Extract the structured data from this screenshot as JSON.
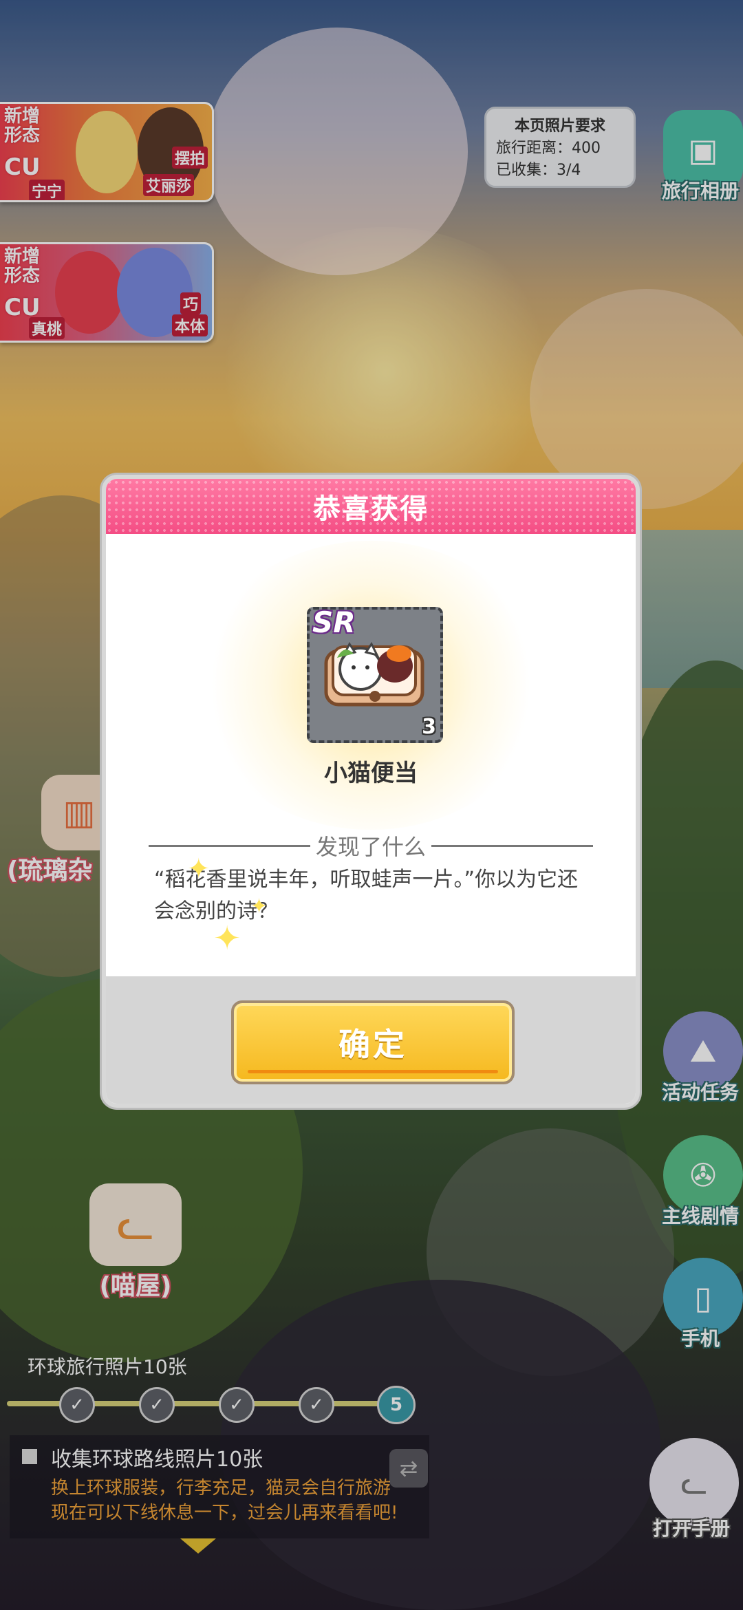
{
  "banners": [
    {
      "tag": "新增\n形态",
      "type": "CU",
      "name_left": "宁宁",
      "name_right": "艾丽莎",
      "note": "摆拍"
    },
    {
      "tag": "新增\n形态",
      "type": "CU",
      "name_left": "真桃",
      "name_right": "本体",
      "note": "巧"
    }
  ],
  "photo_requirement": {
    "heading": "本页照片要求",
    "distance": "旅行距离：400",
    "collected_label": "已收集：",
    "collected_value": "3/4"
  },
  "side_buttons": {
    "album": "旅行相册",
    "event_tasks": "活动任务",
    "main_story": "主线剧情",
    "phone": "手机",
    "handbook": "打开手册"
  },
  "buildings": {
    "glass_shop": "(琉璃杂",
    "cat_house": "(喵屋)"
  },
  "modal": {
    "title": "恭喜获得",
    "item": {
      "rarity": "SR",
      "count": "3",
      "name": "小猫便当"
    },
    "section_title": "发现了什么",
    "description": "“稻花香里说丰年，听取蛙声一片。”你以为它还会念别的诗？",
    "confirm_label": "确定"
  },
  "progress": {
    "title": "环球旅行照片10张",
    "steps": [
      "✓",
      "✓",
      "✓",
      "✓",
      "5"
    ],
    "completed": 4,
    "current_step": 5
  },
  "task": {
    "title": "收集环球路线照片10张",
    "line1": "换上环球服装，行李充足，猫灵会自行旅游",
    "line2": "现在可以下线休息一下，过会儿再来看看吧!"
  },
  "colors": {
    "modal_header": "#f44d84",
    "confirm_button": "#f5b81e",
    "task_text": "#f2a43a",
    "current_step": "#3a9aa8"
  }
}
